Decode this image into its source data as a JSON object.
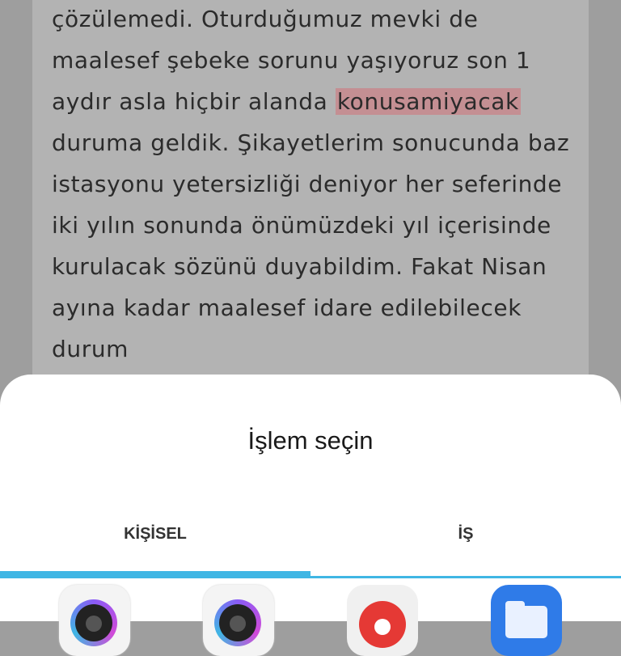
{
  "background_text": {
    "before": "çözülemedi. Oturduğumuz mevki de maalesef şebeke sorunu yaşıyoruz son 1 aydır asla hiçbir alanda ",
    "highlight": "konusamiyacak",
    "after": " duruma geldik. Şikayetlerim sonucunda baz istasyonu yetersizliği deniyor her seferinde iki yılın sonunda önümüzdeki yıl içerisinde kurulacak sözünü duyabildim. Fakat Nisan ayına kadar maalesef idare edilebilecek durum"
  },
  "sheet": {
    "title": "İşlem seçin",
    "tabs": [
      {
        "label": "KİŞİSEL",
        "active": true
      },
      {
        "label": "İŞ",
        "active": false
      }
    ],
    "accent_color": "#3fb6e4",
    "apps": [
      {
        "icon": "camera-icon"
      },
      {
        "icon": "camera-icon"
      },
      {
        "icon": "screen-recorder-icon"
      },
      {
        "icon": "files-folder-icon"
      }
    ]
  }
}
